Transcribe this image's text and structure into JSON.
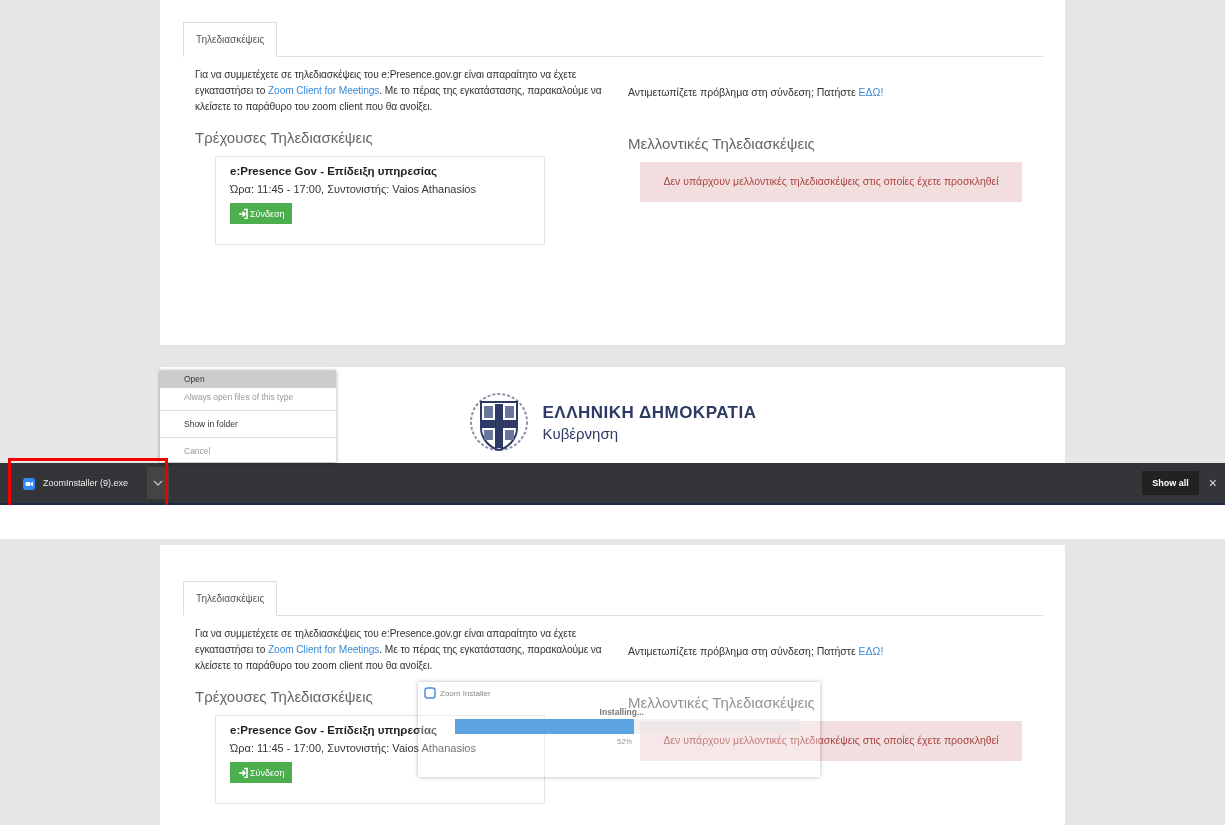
{
  "screens": [
    {
      "page": {
        "tab": {
          "label": "Τηλεδιασκέψεις",
          "selected": true
        },
        "intro": {
          "before": "Για να συμμετέχετε σε τηλεδιασκέψεις του e:Presence.gov.gr είναι απαραίτητο να έχετε εγκαταστήσει το ",
          "link": "Zoom Client for Meetings",
          "after": ". Με το πέρας της εγκατάστασης, παρακαλούμε να κλείσετε το παράθυρο του zoom client που θα ανοίξει."
        },
        "help": {
          "text": "Αντιμετωπίζετε πρόβλημα στη σύνδεση; Πατήστε ",
          "link": "ΕΔΩ!"
        },
        "current_heading": "Τρέχουσες Τηλεδιασκέψεις",
        "meetings": [
          {
            "title": "e:Presence Gov - Επίδειξη υπηρεσίας",
            "meta": "Ώρα: 11:45 - 17:00, Συντονιστής: Vaios Athanasios",
            "button": "Σύνδεση"
          }
        ],
        "upcoming_heading": "Μελλοντικές Τηλεδιασκέψεις",
        "alert": "Δεν υπάρχουν μελλοντικές τηλεδιασκέψεις στις οποίες έχετε προσκληθεί"
      },
      "footer": {
        "title": "ΕΛΛΗΝΙΚΗ ΔΗΜΟΚΡΑΤΙΑ",
        "subtitle": "Κυβέρνηση"
      },
      "context_menu": {
        "items": [
          {
            "label": "Open",
            "selected": true,
            "disabled": false
          },
          {
            "label": "Always open files of this type",
            "selected": false,
            "disabled": true
          },
          {
            "label": "Show in folder",
            "selected": false,
            "disabled": false
          },
          {
            "label": "Cancel",
            "selected": false,
            "disabled": true
          }
        ]
      },
      "download_bar": {
        "file": "ZoomInstaller (9).exe",
        "show_all": "Show all",
        "close": "×"
      }
    },
    {
      "page": {
        "tab": {
          "label": "Τηλεδιασκέψεις",
          "selected": true
        },
        "intro": {
          "before": "Για να συμμετέχετε σε τηλεδιασκέψεις του e:Presence.gov.gr είναι απαραίτητο να έχετε εγκαταστήσει το ",
          "link": "Zoom Client for Meetings",
          "after": ". Με το πέρας της εγκατάστασης, παρακαλούμε να κλείσετε το παράθυρο του zoom client που θα ανοίξει."
        },
        "help": {
          "text": "Αντιμετωπίζετε πρόβλημα στη σύνδεση; Πατήστε ",
          "link": "ΕΔΩ!"
        },
        "current_heading": "Τρέχουσες Τηλεδιασκέψεις",
        "meetings": [
          {
            "title": "e:Presence Gov - Επίδειξη υπηρεσίας",
            "meta": "Ώρα: 11:45 - 17:00, Συντονιστής: Vaios Athanasios",
            "button": "Σύνδεση"
          }
        ],
        "upcoming_heading": "Μελλοντικές Τηλεδιασκέψεις",
        "alert": "Δεν υπάρχουν μελλοντικές τηλεδιασκέψεις στις οποίες έχετε προσκληθεί"
      },
      "installer": {
        "title": "Zoom Installer",
        "status": "Installing...",
        "level": 0.52,
        "percent": "52%"
      }
    }
  ]
}
